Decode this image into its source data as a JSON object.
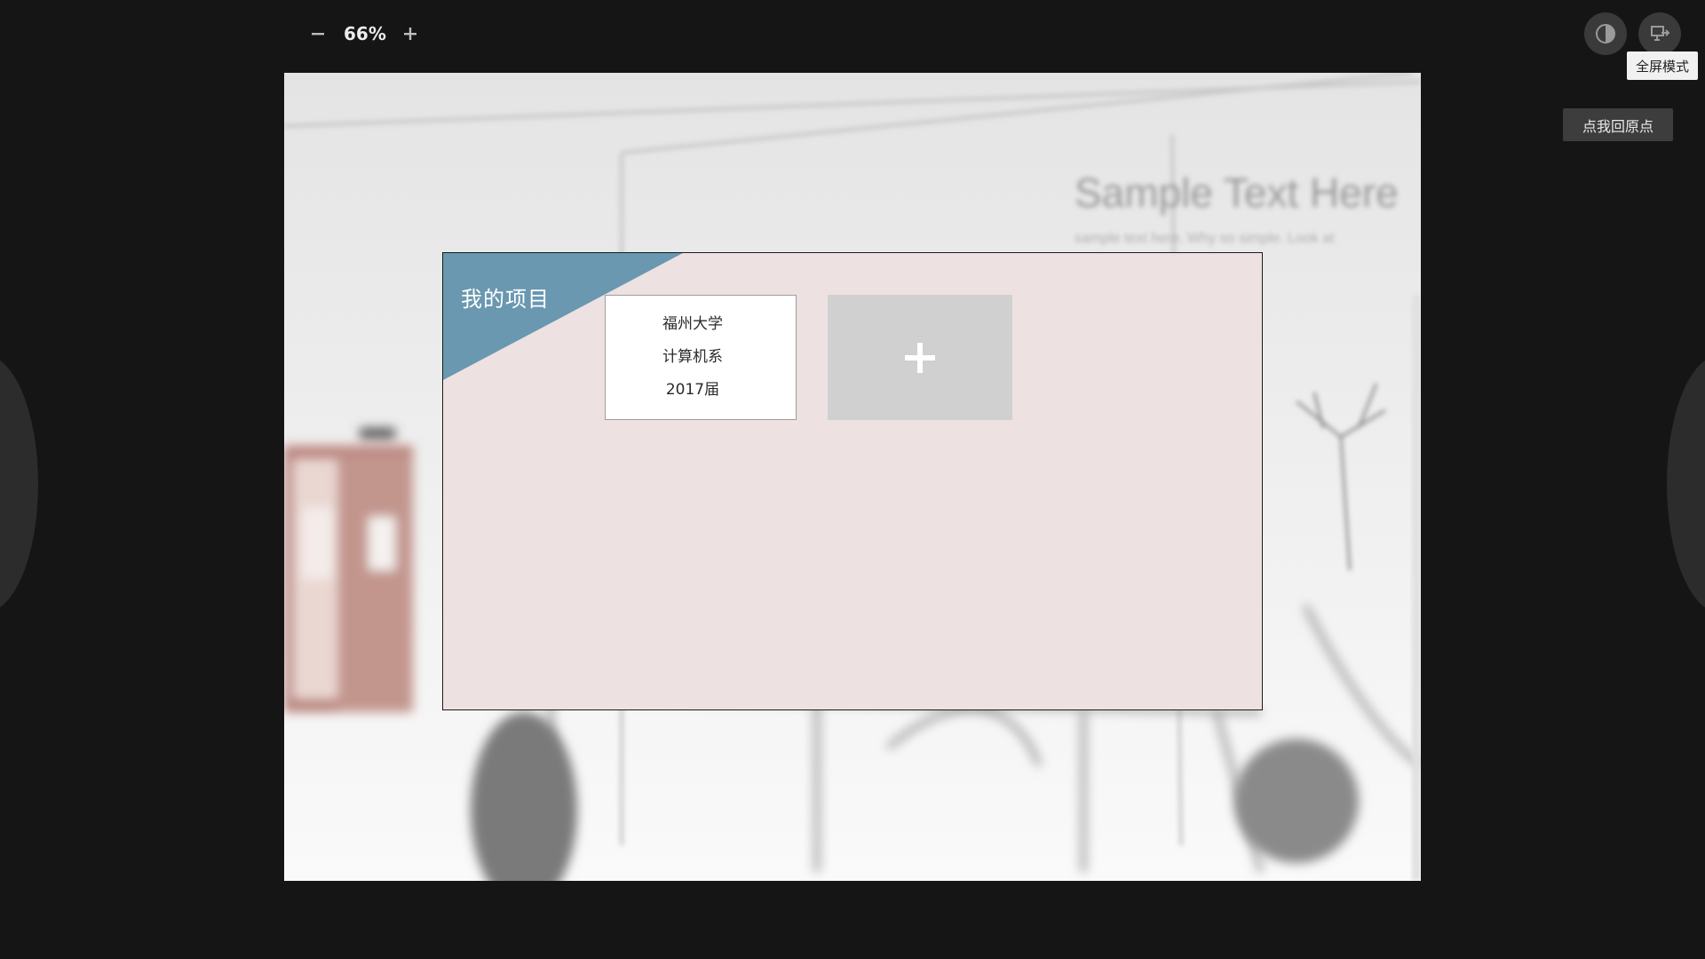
{
  "toolbar": {
    "zoom_out_icon": "minus-icon",
    "zoom_level": "66%",
    "zoom_in_icon": "plus-icon"
  },
  "top_right": {
    "contrast_icon": "contrast-icon",
    "fullscreen_icon": "exit-screen-icon",
    "fullscreen_tooltip": "全屏模式",
    "origin_button_label": "点我回原点"
  },
  "slide": {
    "background_text": {
      "title": "Sample Text Here",
      "body": "sample text here. Why so simple. Look at the tech stats well done right."
    },
    "panel": {
      "title": "我的项目",
      "accent_color": "#6998b0",
      "background_color": "#ede1e1",
      "projects": [
        {
          "lines": [
            "福州大学",
            "计算机系",
            "2017届"
          ]
        }
      ],
      "add_card_icon": "plus-icon"
    }
  }
}
